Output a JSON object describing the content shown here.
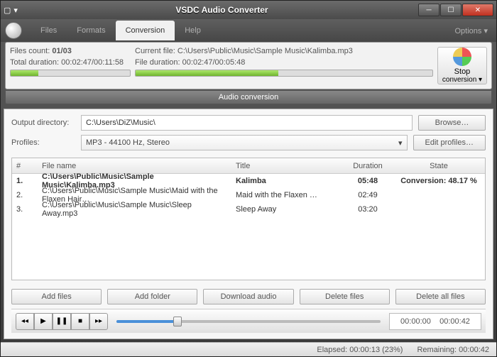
{
  "window": {
    "title": "VSDC Audio Converter"
  },
  "menus": {
    "files": "Files",
    "formats": "Formats",
    "conversion": "Conversion",
    "help": "Help",
    "options": "Options ▾"
  },
  "status": {
    "files_count_label": "Files count:",
    "files_count": "01/03",
    "total_dur_label": "Total duration:",
    "total_dur": "00:02:47/00:11:58",
    "curr_file_label": "Current file:",
    "curr_file": "C:\\Users\\Public\\Music\\Sample Music\\Kalimba.mp3",
    "file_dur_label": "File duration:",
    "file_dur": "00:02:47/00:05:48",
    "stop_label": "Stop",
    "conv_label": "conversion ▾",
    "banner": "Audio conversion",
    "total_pct": 23,
    "file_pct": 48
  },
  "form": {
    "outdir_label": "Output directory:",
    "outdir": "C:\\Users\\DiZ\\Music\\",
    "profiles_label": "Profiles:",
    "profile": "MP3 - 44100 Hz, Stereo",
    "browse": "Browse…",
    "editprof": "Edit profiles…"
  },
  "table": {
    "h_num": "#",
    "h_file": "File name",
    "h_title": "Title",
    "h_dur": "Duration",
    "h_state": "State",
    "rows": [
      {
        "n": "1.",
        "f": "C:\\Users\\Public\\Music\\Sample Music\\Kalimba.mp3",
        "t": "Kalimba",
        "d": "05:48",
        "s": "Conversion: 48.17 %",
        "bold": true
      },
      {
        "n": "2.",
        "f": "C:\\Users\\Public\\Music\\Sample Music\\Maid with the Flaxen Hair…",
        "t": "Maid with the Flaxen …",
        "d": "02:49",
        "s": "",
        "bold": false
      },
      {
        "n": "3.",
        "f": "C:\\Users\\Public\\Music\\Sample Music\\Sleep Away.mp3",
        "t": "Sleep Away",
        "d": "03:20",
        "s": "",
        "bold": false
      }
    ]
  },
  "actions": {
    "addfiles": "Add files",
    "addfolder": "Add folder",
    "download": "Download audio",
    "delfiles": "Delete files",
    "delall": "Delete all files"
  },
  "player": {
    "pos_pct": 23,
    "time_left": "00:00:00",
    "time_right": "00:00:42"
  },
  "footer": {
    "elapsed_label": "Elapsed:",
    "elapsed": "00:00:13 (23%)",
    "remain_label": "Remaining:",
    "remain": "00:00:42"
  }
}
